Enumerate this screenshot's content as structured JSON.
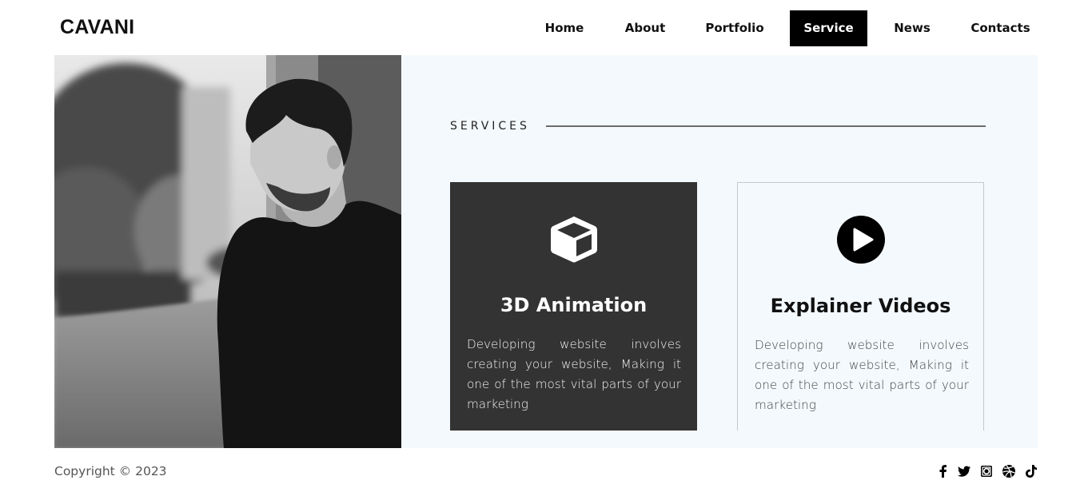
{
  "header": {
    "logo": "CAVANI",
    "nav": [
      {
        "label": "Home"
      },
      {
        "label": "About"
      },
      {
        "label": "Portfolio"
      },
      {
        "label": "Service",
        "active": true
      },
      {
        "label": "News"
      },
      {
        "label": "Contacts"
      }
    ]
  },
  "services": {
    "section_title": "SERVICES",
    "cards": [
      {
        "icon": "cube-icon",
        "title": "3D Animation",
        "text": "Developing website involves creating your website, Making it one of the most vital parts of your marketing"
      },
      {
        "icon": "play-circle-icon",
        "title": "Explainer Videos",
        "text": "Developing website involves creating your website, Making it one of the most vital parts of your marketing"
      }
    ]
  },
  "footer": {
    "copyright": "Copyright © 2023",
    "social": [
      "facebook-icon",
      "twitter-icon",
      "instagram-icon",
      "dribbble-icon",
      "tiktok-icon"
    ]
  },
  "colors": {
    "panel_bg": "#f4f9fd",
    "dark_card": "#333333",
    "active_nav": "#000000"
  }
}
